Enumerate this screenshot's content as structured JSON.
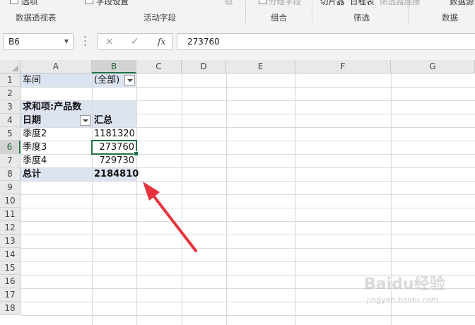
{
  "ribbon": {
    "items": [
      "选项",
      "字段设置",
      "取",
      "分组字段",
      "切片器",
      "日程表",
      "筛选器连接",
      "数据源"
    ],
    "groups": [
      "数据透视表",
      "活动字段",
      "组合",
      "筛选",
      "数据"
    ]
  },
  "formula_bar": {
    "name_box": "B6",
    "cancel_icon": "×",
    "enter_icon": "✓",
    "fx_label": "fx",
    "value": "273760"
  },
  "sheet": {
    "columns": [
      "A",
      "B",
      "C",
      "D",
      "E",
      "F",
      "G"
    ],
    "selected_column": "B",
    "rows": [
      "1",
      "2",
      "3",
      "4",
      "5",
      "6",
      "7",
      "8",
      "9",
      "10",
      "11",
      "12",
      "13",
      "14",
      "15",
      "16",
      "17",
      "18"
    ],
    "selected_row": "6",
    "cells": {
      "a1": "车间",
      "b1": "(全部)",
      "a3": "求和项:产品数",
      "a4": "日期",
      "b4": "汇总",
      "a5": "季度2",
      "b5": "1181320",
      "a6": "季度3",
      "b6": "273760",
      "a7": "季度4",
      "b7": "729730",
      "a8": "总计",
      "b8": "2184810"
    }
  },
  "annotation": {
    "color": "#e8323b"
  },
  "watermark": {
    "text": "Baidu经验",
    "sub": "jingyan.baidu.com"
  }
}
